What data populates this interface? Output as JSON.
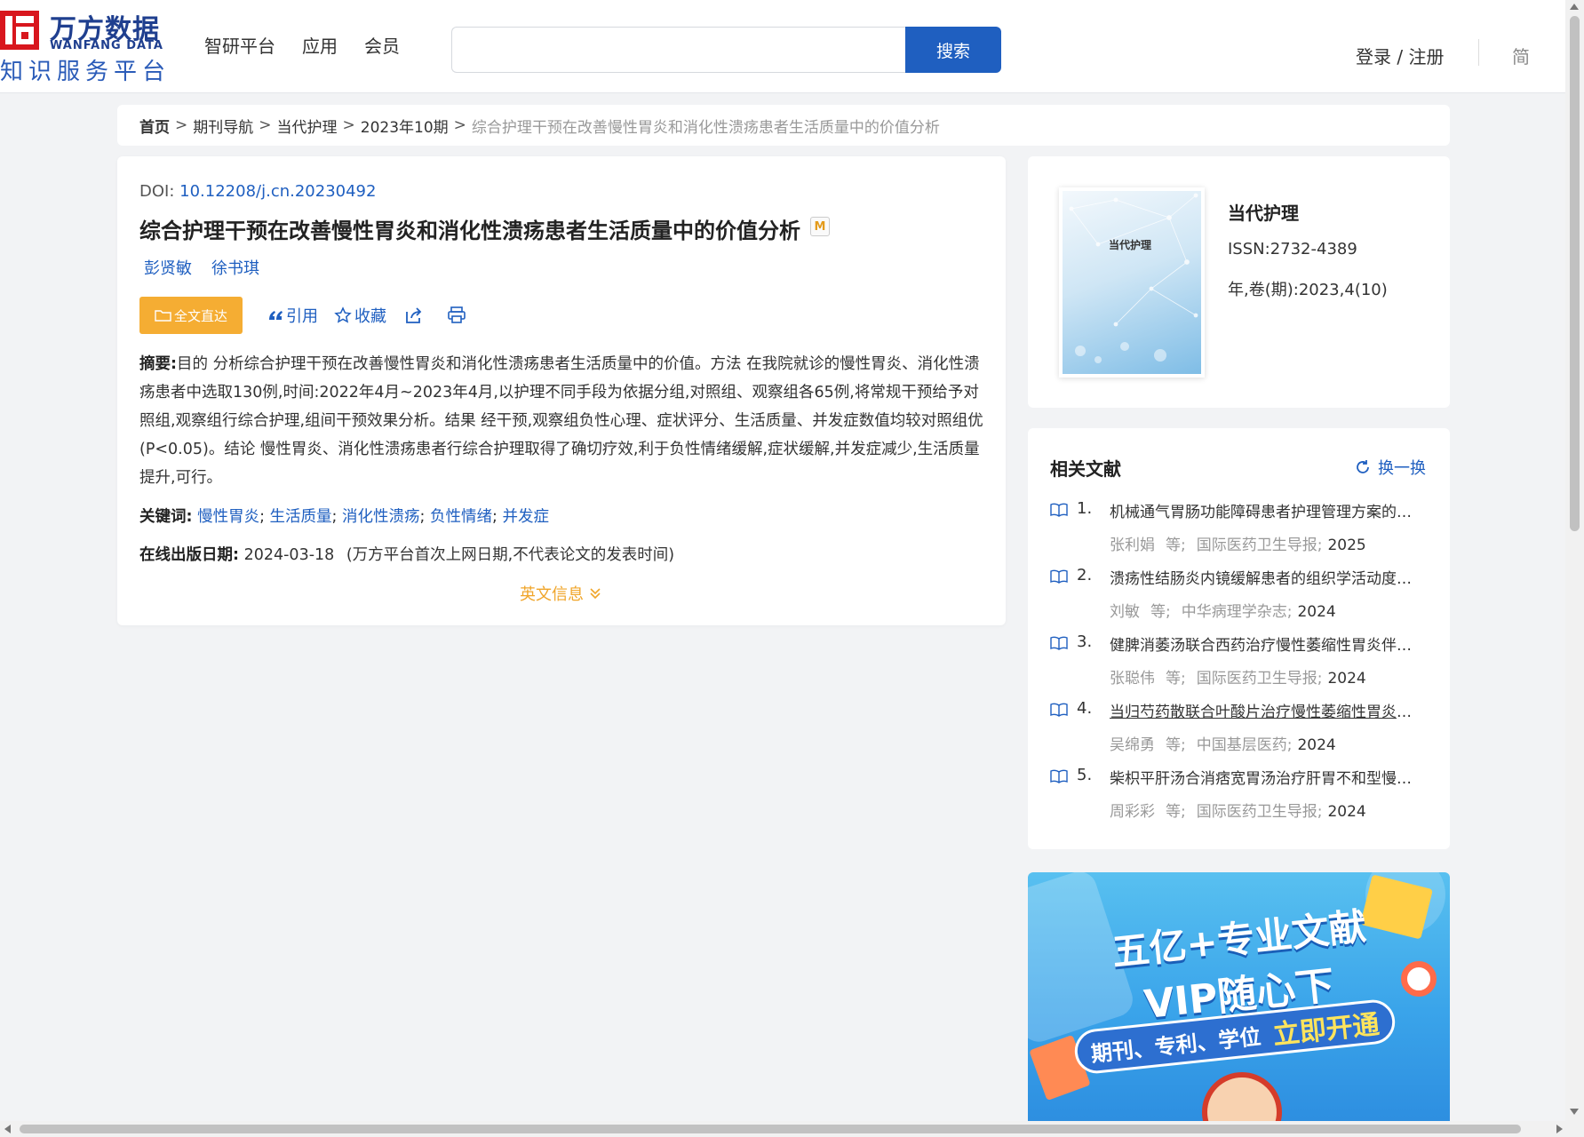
{
  "header": {
    "logo_cn": "万方数据",
    "logo_en": "WANFANG DATA",
    "logo_sub": "知识服务平台",
    "nav": [
      "智研平台",
      "应用",
      "会员"
    ],
    "search_placeholder": "",
    "search_button": "搜索",
    "login": "登录 / 注册",
    "lang": "简"
  },
  "breadcrumb": {
    "home": "首页",
    "items": [
      "期刊导航",
      "当代护理",
      "2023年10期"
    ],
    "current": "综合护理干预在改善慢性胃炎和消化性溃疡患者生活质量中的价值分析",
    "separator": ">"
  },
  "article": {
    "doi_label": "DOI:",
    "doi": "10.12208/j.cn.20230492",
    "title": "综合护理干预在改善慢性胃炎和消化性溃疡患者生活质量中的价值分析",
    "badge": "M",
    "authors": [
      "彭贤敏",
      "徐书琪"
    ],
    "actions": {
      "fulltext": "全文直达",
      "cite": "引用",
      "favorite": "收藏"
    },
    "abstract_label": "摘要:",
    "abstract": "目的 分析综合护理干预在改善慢性胃炎和消化性溃疡患者生活质量中的价值。方法 在我院就诊的慢性胃炎、消化性溃疡患者中选取130例,时间:2022年4月~2023年4月,以护理不同手段为依据分组,对照组、观察组各65例,将常规干预给予对照组,观察组行综合护理,组间干预效果分析。结果 经干预,观察组负性心理、症状评分、生活质量、并发症数值均较对照组优(P<0.05)。结论 慢性胃炎、消化性溃疡患者行综合护理取得了确切疗效,利于负性情绪缓解,症状缓解,并发症减少,生活质量提升,可行。",
    "keywords_label": "关键词:",
    "keywords": [
      "慢性胃炎",
      "生活质量",
      "消化性溃疡",
      "负性情绪",
      "并发症"
    ],
    "pubdate_label": "在线出版日期:",
    "pubdate": "2024-03-18",
    "pubdate_note": "(万方平台首次上网日期,不代表论文的发表时间)",
    "english_info": "英文信息"
  },
  "journal": {
    "cover_title": "当代护理",
    "name": "当代护理",
    "issn": "ISSN:2732-4389",
    "volume": "年,卷(期):2023,4(10)"
  },
  "related": {
    "title": "相关文献",
    "refresh": "换一换",
    "items": [
      {
        "num": "1.",
        "title": "机械通气胃肠功能障碍患者护理管理方案的构建及应用",
        "author": "张利娟",
        "etal": "等;",
        "source": "国际医药卫生导报;",
        "year": "2025"
      },
      {
        "num": "2.",
        "title": "溃疡性结肠炎内镜缓解患者的组织学活动度评估",
        "author": "刘敏",
        "etal": "等;",
        "source": "中华病理学杂志;",
        "year": "2024"
      },
      {
        "num": "3.",
        "title": "健脾消萎汤联合西药治疗慢性萎缩性胃炎伴肠化生",
        "author": "张聪伟",
        "etal": "等;",
        "source": "国际医药卫生导报;",
        "year": "2024"
      },
      {
        "num": "4.",
        "title": "当归芍药散联合叶酸片治疗慢性萎缩性胃炎的疗效观察",
        "author": "吴绵勇",
        "etal": "等;",
        "source": "中国基层医药;",
        "year": "2024"
      },
      {
        "num": "5.",
        "title": "柴枳平肝汤合消痞宽胃汤治疗肝胃不和型慢性胃炎",
        "author": "周彩彩",
        "etal": "等;",
        "source": "国际医药卫生导报;",
        "year": "2024"
      }
    ]
  },
  "ad": {
    "line1": "五亿+专业文献",
    "line2": "VIP随心下",
    "pill_a": "期刊、专利、学位",
    "pill_b": "立即开通"
  },
  "colors": {
    "brand_red": "#d8161d",
    "brand_blue": "#1f5fc0",
    "accent_orange": "#f5ad33"
  }
}
